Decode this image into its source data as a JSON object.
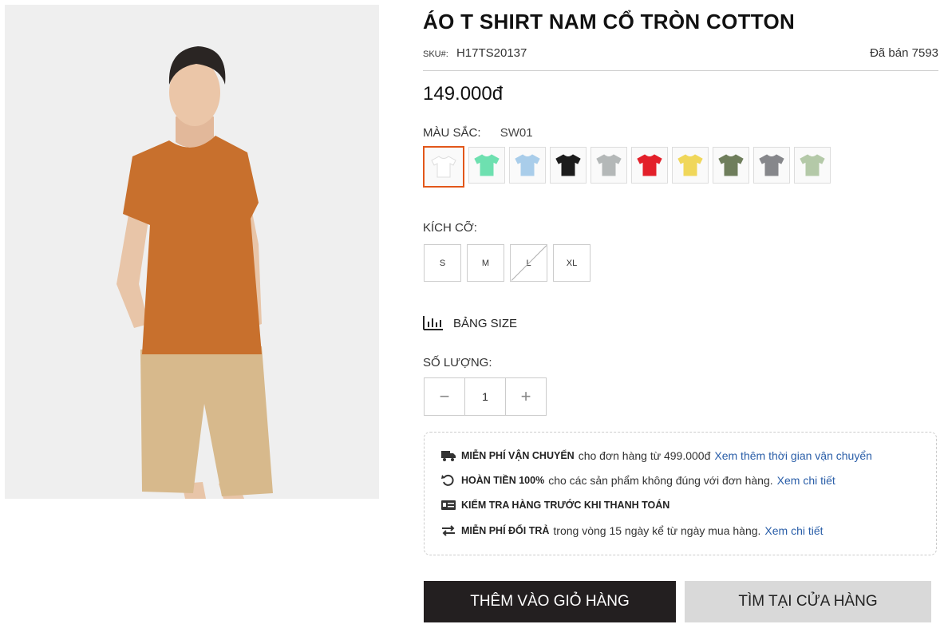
{
  "product": {
    "title": "ÁO T SHIRT NAM CỔ TRÒN COTTON",
    "sku_label": "SKU#:",
    "sku": "H17TS20137",
    "sold": "Đã bán 7593",
    "price": "149.000đ"
  },
  "color": {
    "label": "MÀU SẮC:",
    "selected": "SW01",
    "swatches": [
      "#ffffff",
      "#6ee0b0",
      "#a9cdea",
      "#1c1c1c",
      "#b4b8b8",
      "#e3202a",
      "#f0d75a",
      "#6f7e5c",
      "#86878b",
      "#b4c9a8"
    ]
  },
  "size": {
    "label": "KÍCH CỠ:",
    "options": [
      "S",
      "M",
      "L",
      "XL"
    ],
    "unavailable": "L"
  },
  "size_chart": {
    "label": "BẢNG SIZE"
  },
  "quantity": {
    "label": "SỐ LƯỢNG:",
    "value": "1",
    "minus": "−",
    "plus": "+"
  },
  "policies": [
    {
      "icon": "truck-icon",
      "bold": "MIỄN PHÍ VẬN CHUYỂN",
      "text": "cho đơn hàng từ 499.000đ",
      "link": "Xem thêm thời gian vận chuyển"
    },
    {
      "icon": "refund-icon",
      "bold": "HOÀN TIỀN 100%",
      "text": "cho các sản phẩm không đúng với đơn hàng.",
      "link": "Xem chi tiết"
    },
    {
      "icon": "payment-card-icon",
      "bold": "KIỂM TRA HÀNG TRƯỚC KHI THANH TOÁN",
      "text": "",
      "link": ""
    },
    {
      "icon": "exchange-icon",
      "bold": "MIỄN PHÍ ĐỔI TRẢ",
      "text": "trong vòng 15 ngày kể từ ngày mua hàng.",
      "link": "Xem chi tiết"
    }
  ],
  "buttons": {
    "add_to_cart": "THÊM VÀO GIỎ HÀNG",
    "find_in_store": "TÌM TẠI CỬA HÀNG"
  },
  "colors": {
    "accent": "#e2571a",
    "link": "#2a5ea8",
    "cart_button": "#231f20",
    "store_button": "#d9d9d9"
  }
}
